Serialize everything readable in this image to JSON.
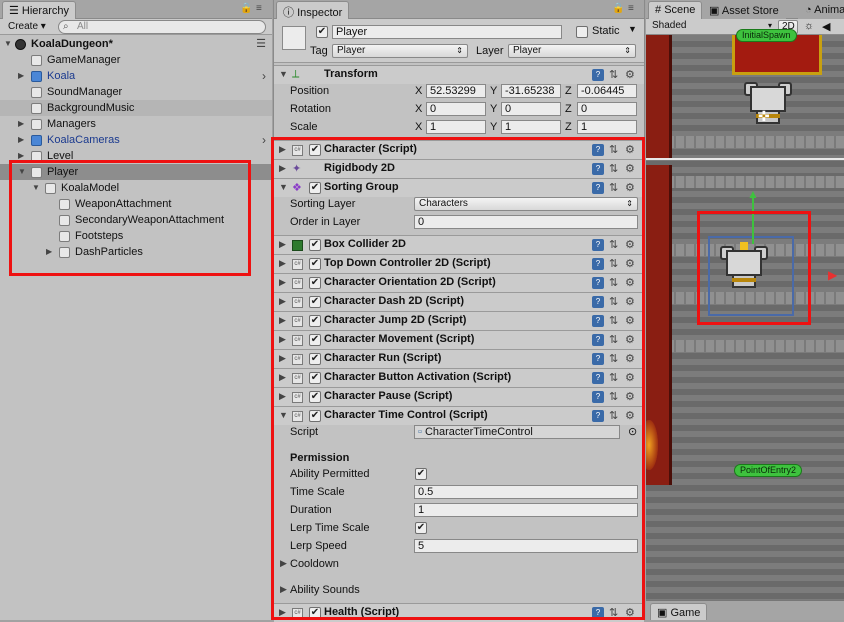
{
  "hierarchy": {
    "tab_label": "Hierarchy",
    "create_label": "Create",
    "search_placeholder": "All",
    "scene_name": "KoalaDungeon*",
    "items": [
      {
        "label": "GameManager"
      },
      {
        "label": "Koala"
      },
      {
        "label": "SoundManager"
      },
      {
        "label": "BackgroundMusic"
      },
      {
        "label": "Managers"
      },
      {
        "label": "KoalaCameras"
      },
      {
        "label": "Level"
      },
      {
        "label": "Player"
      },
      {
        "label": "KoalaModel"
      },
      {
        "label": "WeaponAttachment"
      },
      {
        "label": "SecondaryWeaponAttachment"
      },
      {
        "label": "Footsteps"
      },
      {
        "label": "DashParticles"
      }
    ]
  },
  "inspector": {
    "tab_label": "Inspector",
    "object_name": "Player",
    "static_label": "Static",
    "tag_label": "Tag",
    "tag_value": "Player",
    "layer_label": "Layer",
    "layer_value": "Player",
    "transform": {
      "title": "Transform",
      "position_label": "Position",
      "rotation_label": "Rotation",
      "scale_label": "Scale",
      "axes": [
        "X",
        "Y",
        "Z"
      ],
      "position": [
        "52.53299",
        "-31.65238",
        "-0.06445"
      ],
      "rotation": [
        "0",
        "0",
        "0"
      ],
      "scale": [
        "1",
        "1",
        "1"
      ]
    },
    "components": [
      {
        "title": "Character (Script)"
      },
      {
        "title": "Rigidbody 2D"
      },
      {
        "title": "Sorting Group"
      },
      {
        "title": "Box Collider 2D"
      },
      {
        "title": "Top Down Controller 2D (Script)"
      },
      {
        "title": "Character Orientation 2D (Script)"
      },
      {
        "title": "Character Dash 2D (Script)"
      },
      {
        "title": "Character Jump 2D (Script)"
      },
      {
        "title": "Character Movement (Script)"
      },
      {
        "title": "Character Run (Script)"
      },
      {
        "title": "Character Button Activation (Script)"
      },
      {
        "title": "Character Pause (Script)"
      },
      {
        "title": "Character Time Control (Script)"
      },
      {
        "title": "Health (Script)"
      }
    ],
    "sorting_group": {
      "layer_label": "Sorting Layer",
      "layer_value": "Characters",
      "order_label": "Order in Layer",
      "order_value": "0"
    },
    "time_control": {
      "script_label": "Script",
      "script_value": "CharacterTimeControl",
      "permission_header": "Permission",
      "ability_permitted_label": "Ability Permitted",
      "time_scale_label": "Time Scale",
      "time_scale_value": "0.5",
      "duration_label": "Duration",
      "duration_value": "1",
      "lerp_time_scale_label": "Lerp Time Scale",
      "lerp_speed_label": "Lerp Speed",
      "lerp_speed_value": "5",
      "cooldown_label": "Cooldown",
      "ability_sounds_label": "Ability Sounds"
    }
  },
  "scene": {
    "tabs": [
      "Scene",
      "Asset Store",
      "Anima"
    ],
    "shading_mode": "Shaded",
    "mode_2d_label": "2D",
    "badge_top": "InitialSpawn",
    "badge_point": "PointOfEntry2",
    "game_tab_label": "Game"
  },
  "colors": {
    "highlight_box": "#ee1111",
    "selection": "#8d8d8d",
    "panel_bg": "#c2c2c2"
  }
}
